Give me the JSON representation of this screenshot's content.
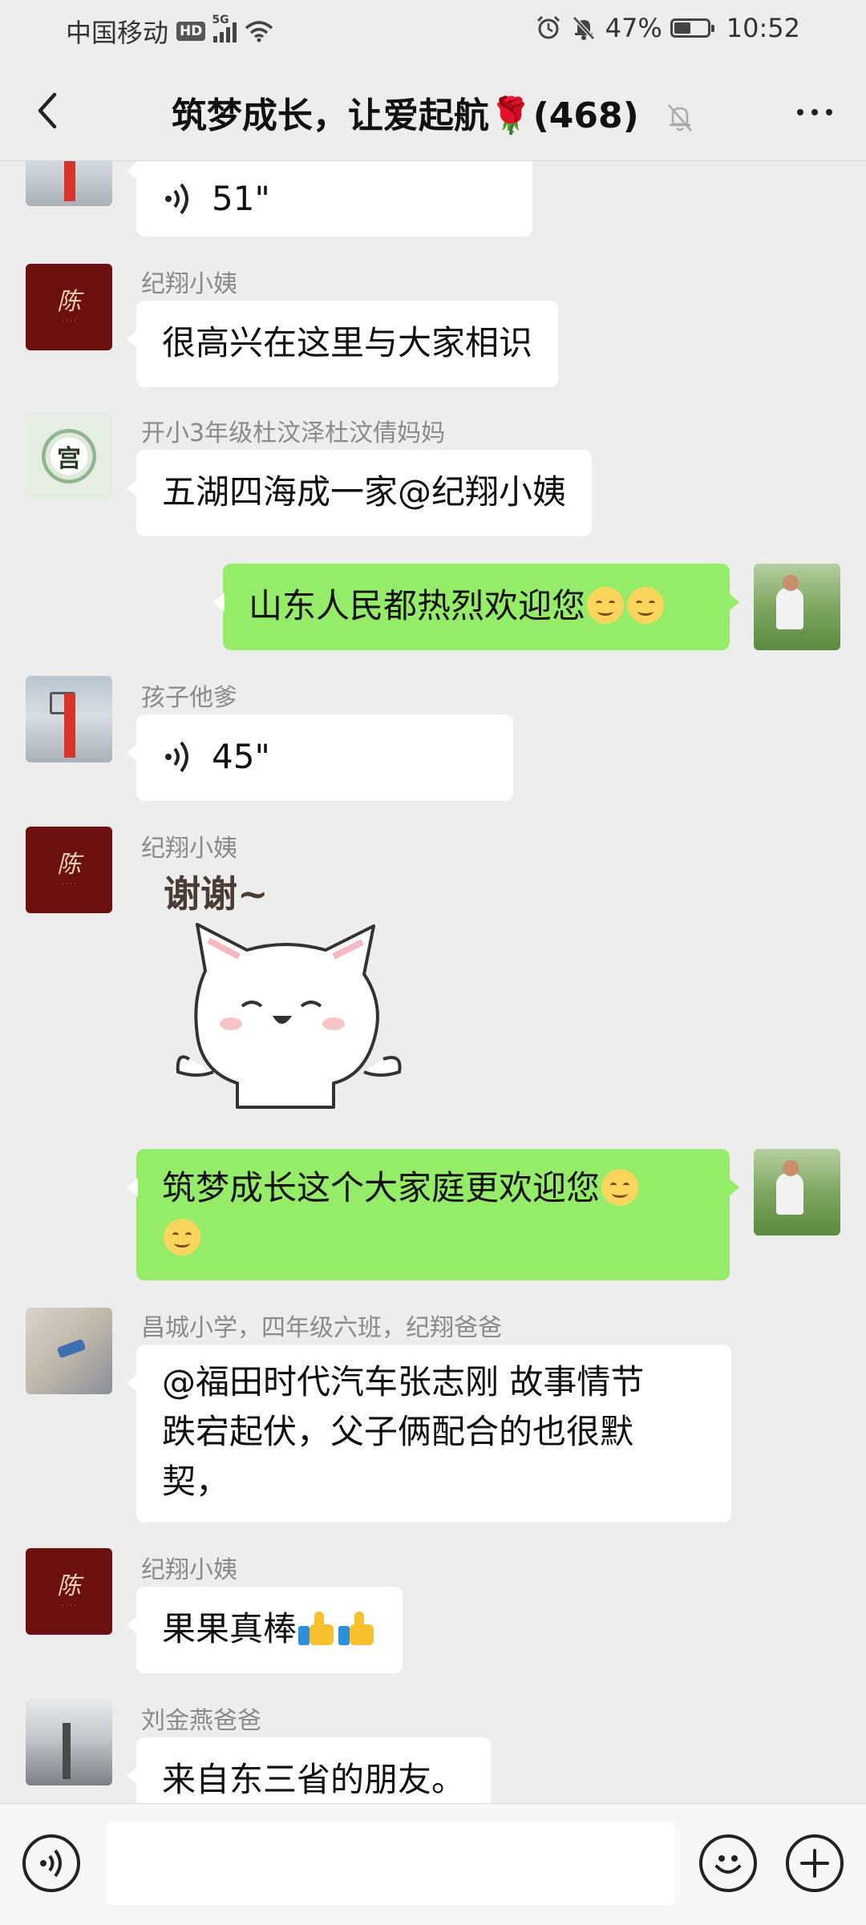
{
  "status_bar": {
    "carrier": "中国移动",
    "hd": "HD",
    "network": "5G",
    "battery_percent": "47%",
    "battery_level": 0.47,
    "time": "10:52"
  },
  "header": {
    "title": "筑梦成长，让爱起航🌹(468)",
    "icons": [
      "back-icon",
      "mute-bell-icon",
      "more-icon"
    ]
  },
  "messages": [
    {
      "direction": "in",
      "type": "voice",
      "duration": "51\""
    },
    {
      "direction": "in",
      "type": "text",
      "sender": "纪翔小姨",
      "text": "很高兴在这里与大家相识"
    },
    {
      "direction": "in",
      "type": "text",
      "sender": "开小3年级杜汶泽杜汶倩妈妈",
      "text": "五湖四海成一家@纪翔小姨"
    },
    {
      "direction": "out",
      "type": "text",
      "text": "山东人民都热烈欢迎您"
    },
    {
      "direction": "in",
      "type": "voice",
      "sender": "孩子他爹",
      "duration": "45\""
    },
    {
      "direction": "in",
      "type": "sticker",
      "sender": "纪翔小姨",
      "sticker_text": "谢谢~"
    },
    {
      "direction": "out",
      "type": "text",
      "text": "筑梦成长这个大家庭更欢迎您"
    },
    {
      "direction": "in",
      "type": "text",
      "sender": "昌城小学，四年级六班，纪翔爸爸",
      "text_lines": [
        "@福田时代汽车张志刚  故事情节",
        "跌宕起伏，父子俩配合的也很默",
        "契，"
      ]
    },
    {
      "direction": "in",
      "type": "text",
      "sender": "纪翔小姨",
      "text": "果果真棒"
    },
    {
      "direction": "in",
      "type": "text",
      "sender": "刘金燕爸爸",
      "text": "来自东三省的朋友。"
    }
  ],
  "input_bar": {
    "value": "",
    "icons": [
      "voice-input-icon",
      "emoji-icon",
      "plus-icon"
    ]
  },
  "colors": {
    "background": "#ededed",
    "outgoing_bubble": "#95ec69",
    "incoming_bubble": "#ffffff"
  }
}
